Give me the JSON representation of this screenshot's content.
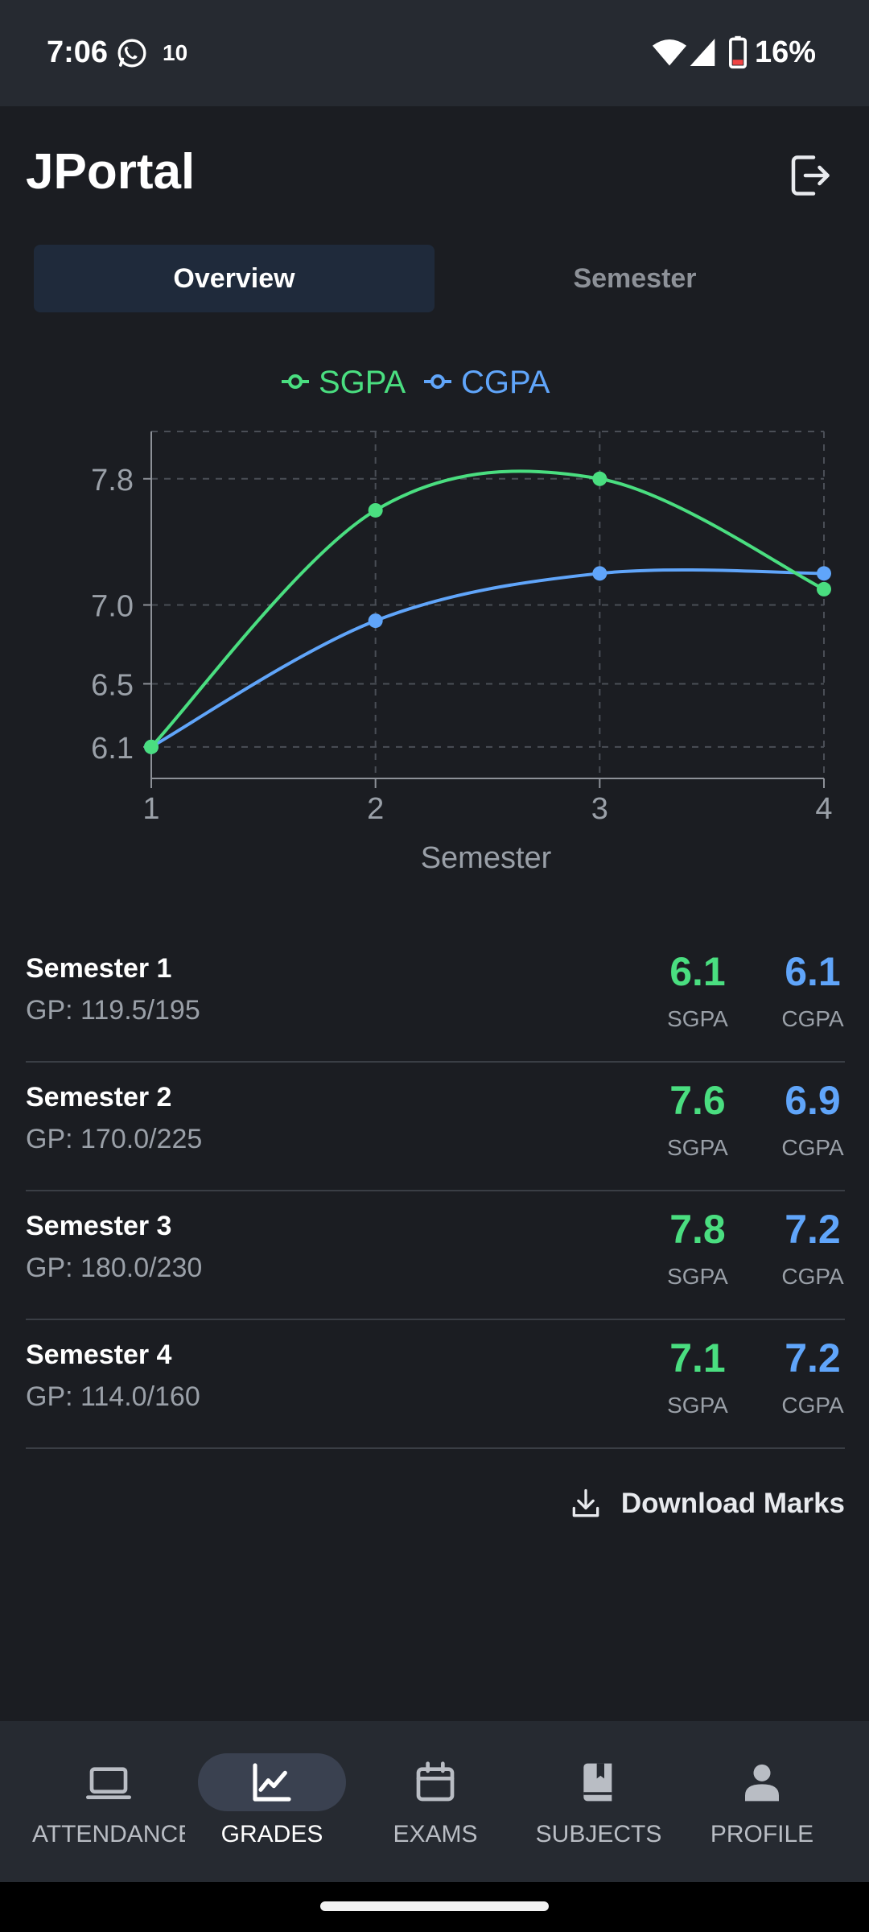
{
  "status": {
    "time": "7:06",
    "notification_text": "10",
    "battery": "16%",
    "icons": [
      "whatsapp-icon",
      "wifi-icon",
      "signal-icon",
      "battery-icon"
    ]
  },
  "header": {
    "title": "JPortal",
    "logout_icon": "logout-icon"
  },
  "tabs": [
    {
      "label": "Overview",
      "active": true
    },
    {
      "label": "Semester",
      "active": false
    }
  ],
  "colors": {
    "sgpa": "#4ade80",
    "cgpa": "#60a5fa",
    "bg": "#1b1d22",
    "panel": "#262a31"
  },
  "chart_data": {
    "type": "line",
    "x": [
      1,
      2,
      3,
      4
    ],
    "xlabel": "Semester",
    "ylabel": "",
    "xlim": [
      1,
      4
    ],
    "ylim": [
      5.9,
      8.1
    ],
    "yticks": [
      6.1,
      6.5,
      7.0,
      7.8
    ],
    "xticks": [
      1,
      2,
      3,
      4
    ],
    "legend": "top-center",
    "grid": true,
    "series": [
      {
        "name": "SGPA",
        "values": [
          6.1,
          7.6,
          7.8,
          7.1
        ],
        "color": "#4ade80"
      },
      {
        "name": "CGPA",
        "values": [
          6.1,
          6.9,
          7.2,
          7.2
        ],
        "color": "#60a5fa"
      }
    ]
  },
  "semesters": [
    {
      "name": "Semester 1",
      "gp": "GP: 119.5/195",
      "sgpa": "6.1",
      "cgpa": "6.1"
    },
    {
      "name": "Semester 2",
      "gp": "GP: 170.0/225",
      "sgpa": "7.6",
      "cgpa": "6.9"
    },
    {
      "name": "Semester 3",
      "gp": "GP: 180.0/230",
      "sgpa": "7.8",
      "cgpa": "7.2"
    },
    {
      "name": "Semester 4",
      "gp": "GP: 114.0/160",
      "sgpa": "7.1",
      "cgpa": "7.2"
    }
  ],
  "labels": {
    "sgpa": "SGPA",
    "cgpa": "CGPA"
  },
  "download": {
    "label": "Download Marks",
    "icon": "download-icon"
  },
  "nav": [
    {
      "label": "ATTENDANCE",
      "icon": "monitor-icon",
      "active": false
    },
    {
      "label": "GRADES",
      "icon": "chart-line-icon",
      "active": true
    },
    {
      "label": "EXAMS",
      "icon": "calendar-icon",
      "active": false
    },
    {
      "label": "SUBJECTS",
      "icon": "book-icon",
      "active": false
    },
    {
      "label": "PROFILE",
      "icon": "person-icon",
      "active": false
    }
  ]
}
